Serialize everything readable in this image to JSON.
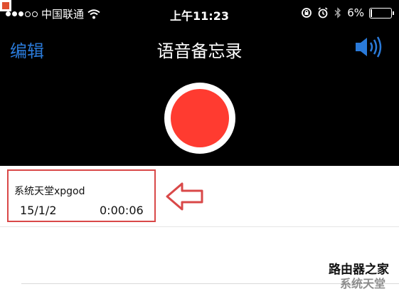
{
  "status_bar": {
    "carrier": "中国联通",
    "time": "上午11:23",
    "battery_percent": "6%"
  },
  "nav": {
    "edit_label": "编辑",
    "title": "语音备忘录"
  },
  "memo": {
    "name": "系统天堂xpgod",
    "date": "15/1/2",
    "duration": "0:00:06"
  },
  "icons": {
    "signal": "signal-dots-icon",
    "wifi": "wifi-icon",
    "rotation_lock": "rotation-lock-icon",
    "alarm": "alarm-icon",
    "bluetooth": "bluetooth-icon",
    "battery": "battery-icon",
    "speaker": "speaker-icon",
    "record": "record-button"
  },
  "colors": {
    "accent_blue": "#2a7ad9",
    "record_red": "#ff3b30",
    "annotation_red": "#d94848"
  }
}
